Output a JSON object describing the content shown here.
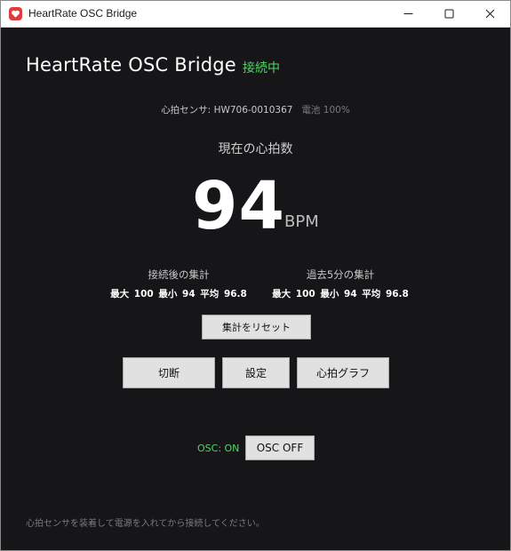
{
  "window": {
    "title": "HeartRate OSC Bridge"
  },
  "header": {
    "title": "HeartRate OSC Bridge",
    "status": "接続中"
  },
  "sensor": {
    "info": "心拍センサ: HW706-0010367",
    "battery": "電池 100%"
  },
  "heart_rate": {
    "label": "現在の心拍数",
    "value": "94",
    "unit": "BPM"
  },
  "stats": {
    "since_connect": {
      "title": "接続後の集計",
      "values": "最大 100  最小 94  平均 96.8"
    },
    "last_5min": {
      "title": "過去5分の集計",
      "values": "最大 100  最小 94  平均 96.8"
    }
  },
  "buttons": {
    "reset": "集計をリセット",
    "disconnect": "切断",
    "settings": "設定",
    "graph": "心拍グラフ",
    "osc_off": "OSC OFF"
  },
  "osc": {
    "status": "OSC: ON"
  },
  "footer": {
    "hint": "心拍センサを装着して電源を入れてから接続してください。"
  },
  "colors": {
    "background": "#161619",
    "connected": "#4cd964",
    "button": "#e1e1e1",
    "app_icon": "#e23b3b"
  },
  "icons": {
    "app": "heart-app-icon",
    "minimize": "minimize-icon",
    "maximize": "maximize-icon",
    "close": "close-icon"
  }
}
